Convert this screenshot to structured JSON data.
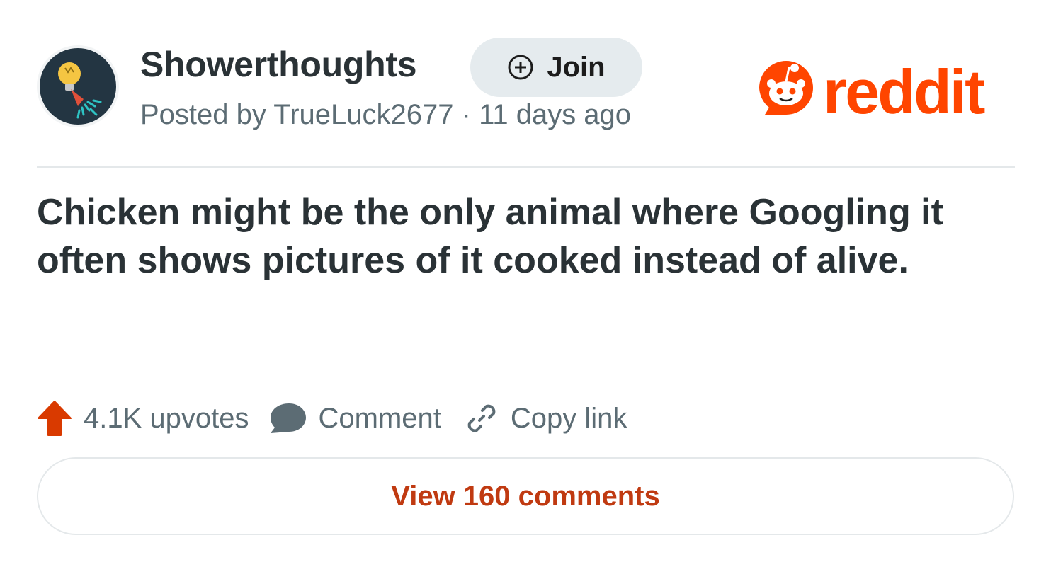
{
  "post": {
    "community": "Showerthoughts",
    "join_label": "Join",
    "meta": "Posted by TrueLuck2677 · 11 days ago",
    "title": "Chicken might be the only animal where Googling it often shows pictures of it cooked instead of alive.",
    "upvotes": "4.1K upvotes",
    "comment_label": "Comment",
    "copy_link_label": "Copy link",
    "view_comments_label": "View 160 comments"
  },
  "brand": {
    "logo_text": "reddit",
    "accent_color": "#ff4500",
    "link_color": "#c03a11"
  },
  "icons": {
    "avatar": "showerthoughts-avatar-icon",
    "join": "plus-circle-icon",
    "logo": "reddit-snoo-icon",
    "upvote": "upvote-arrow-icon",
    "comment": "comment-bubble-icon",
    "copy_link": "link-icon"
  }
}
